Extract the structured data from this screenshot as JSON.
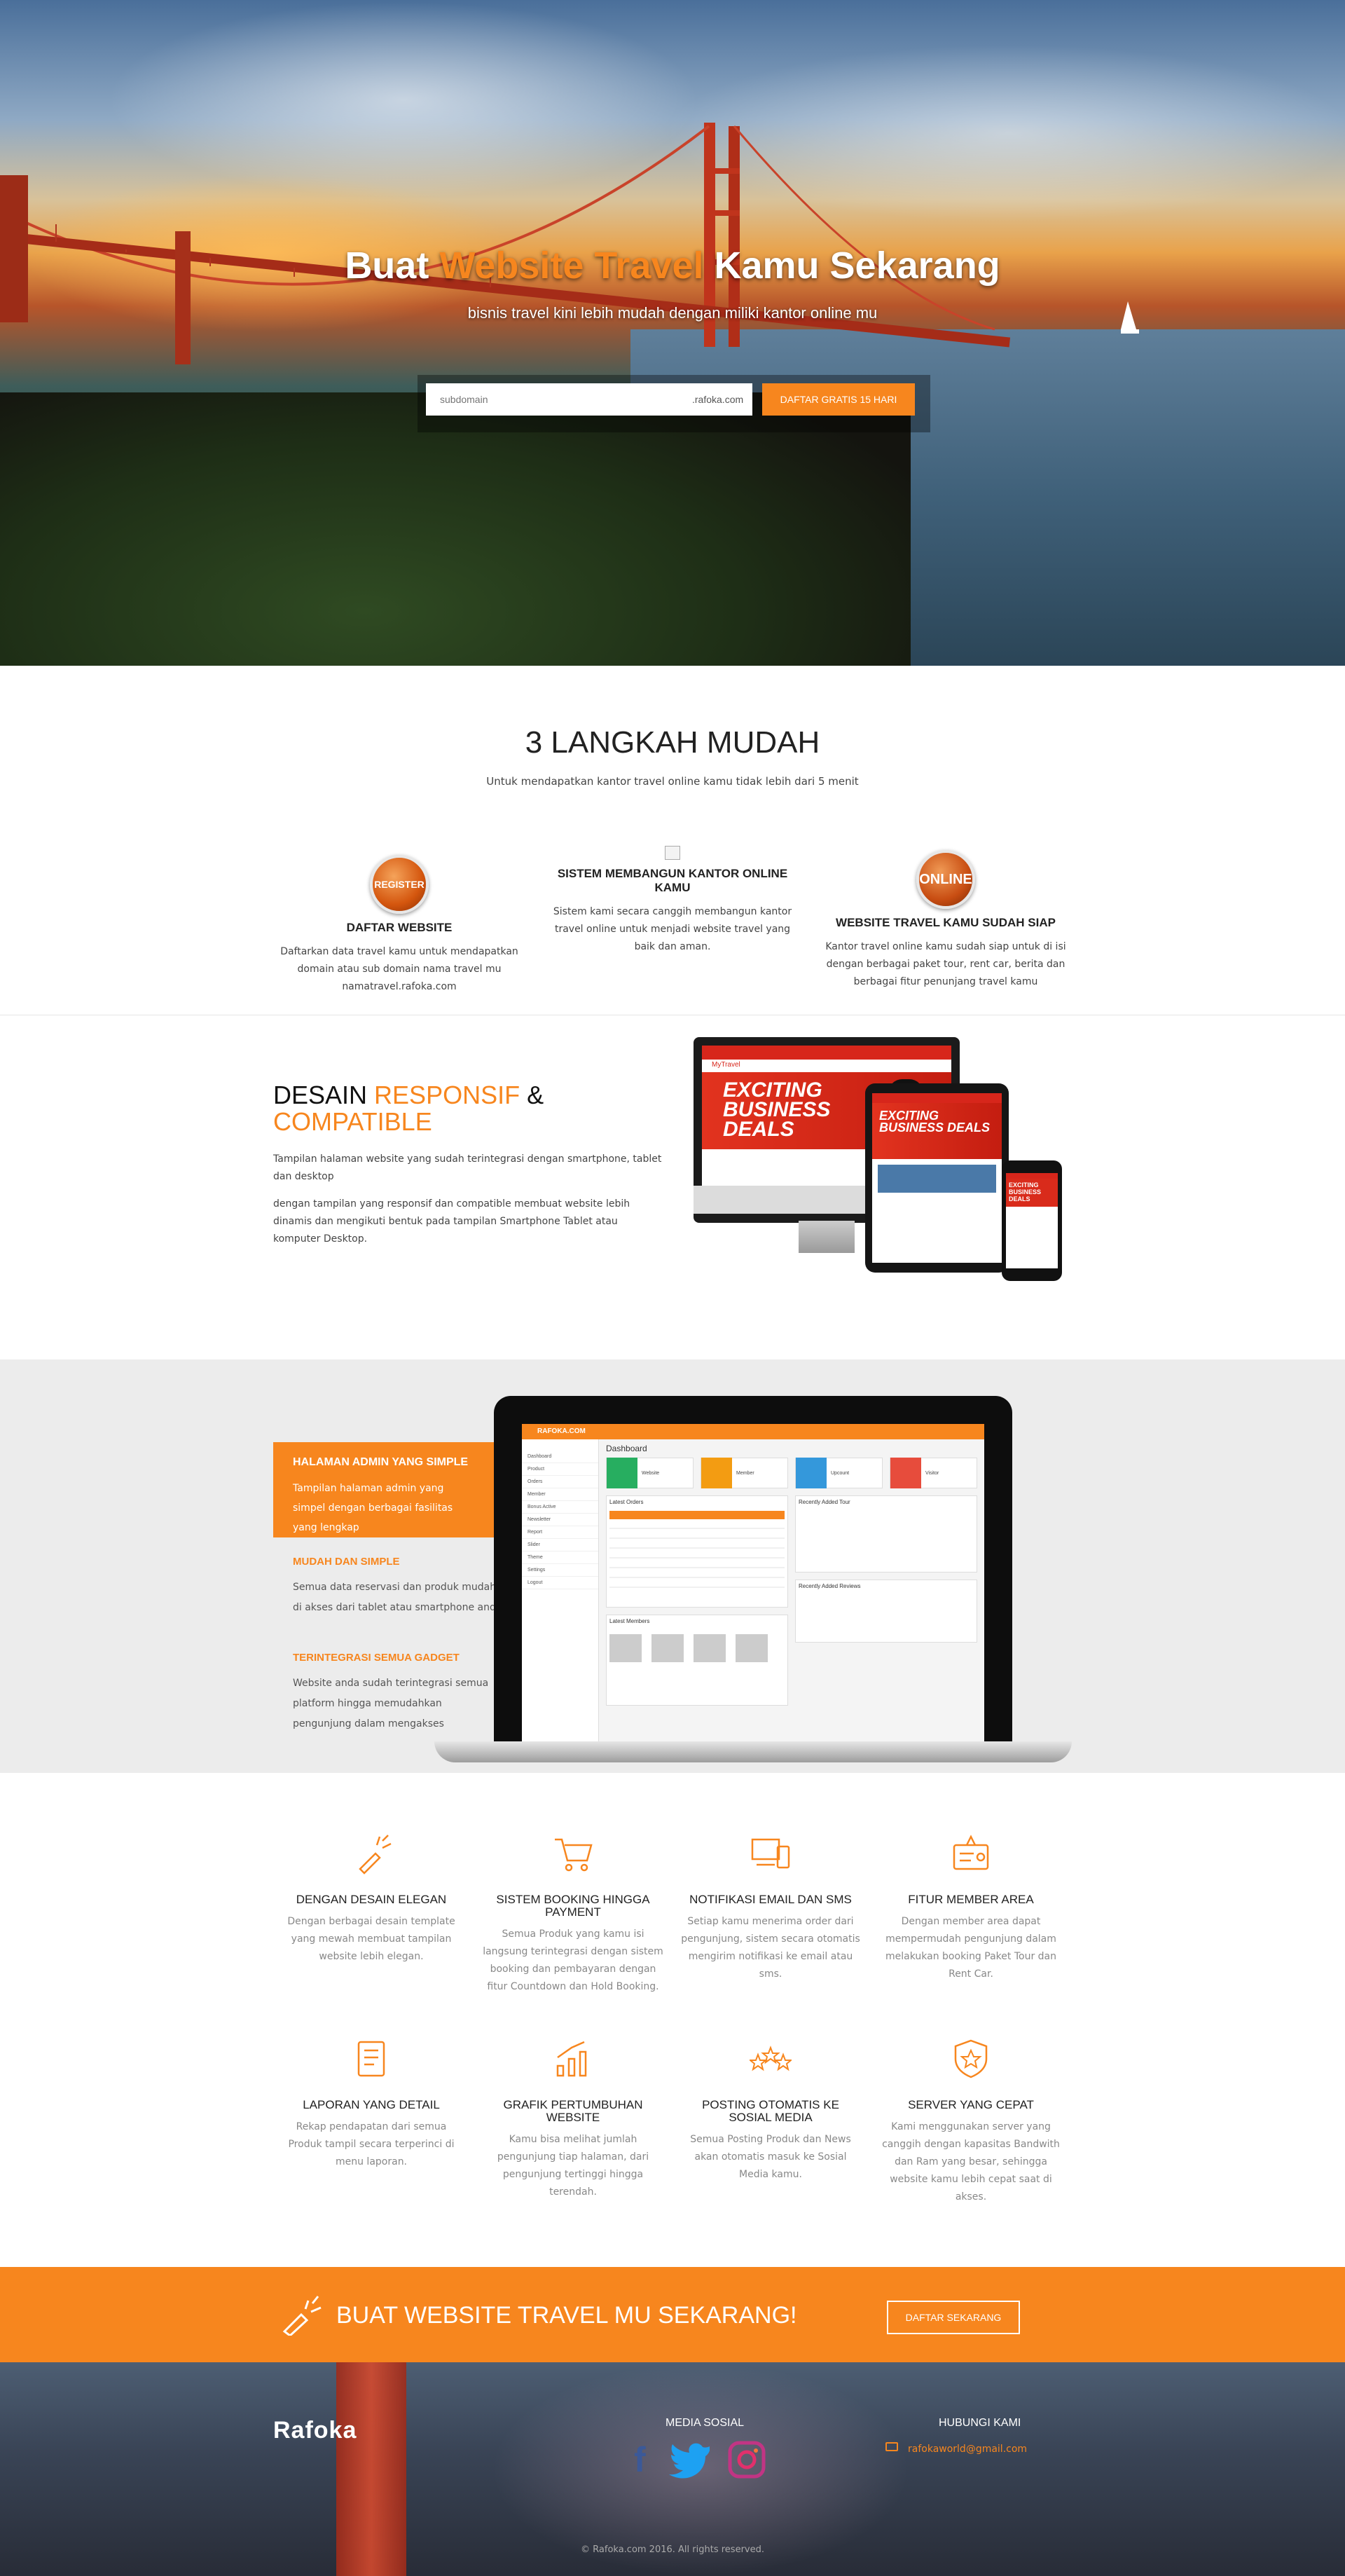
{
  "hero": {
    "title_pre": "Buat ",
    "title_highlight": "Website Travel",
    "title_post": " Kamu Sekarang",
    "subtitle": "bisnis travel kini lebih mudah dengan miliki kantor online mu",
    "subdomain_placeholder": "subdomain",
    "domain_suffix": ".rafoka.com",
    "signup_button": "DAFTAR GRATIS 15 HARI"
  },
  "steps": {
    "title": "3 LANGKAH MUDAH",
    "subtitle": "Untuk mendapatkan kantor travel online kamu tidak lebih dari 5 menit",
    "items": [
      {
        "icon_text": "REGISTER",
        "heading": "DAFTAR WEBSITE",
        "text": "Daftarkan data travel kamu untuk mendapatkan domain atau sub domain nama travel mu namatravel.rafoka.com"
      },
      {
        "heading": "SISTEM MEMBANGUN KANTOR ONLINE KAMU",
        "text": "Sistem kami secara canggih membangun kantor travel online untuk menjadi website travel yang baik dan aman."
      },
      {
        "icon_text": "ONLINE",
        "heading": "WEBSITE TRAVEL KAMU SUDAH SIAP",
        "text": "Kantor travel online kamu sudah siap untuk di isi dengan berbagai paket tour, rent car, berita dan berbagai fitur penunjang travel kamu"
      }
    ]
  },
  "responsive": {
    "title_a": "DESAIN ",
    "title_b": "RESPONSIF",
    "title_c": " &",
    "title_d": "COMPATIBLE",
    "p1": "Tampilan halaman website yang sudah terintegrasi dengan smartphone, tablet dan desktop",
    "p2": "dengan tampilan yang responsif dan compatible membuat website lebih dinamis dan mengikuti bentuk pada tampilan Smartphone Tablet atau komputer Desktop.",
    "screen_brand": "MyTravel",
    "screen_promo": "EXCITING BUSINESS DEALS"
  },
  "admin": {
    "box_title": "HALAMAN ADMIN YANG SIMPLE",
    "box_text": "Tampilan halaman admin yang simpel dengan berbagai fasilitas yang lengkap",
    "item1_title": "MUDAH DAN SIMPLE",
    "item1_text": "Semua data reservasi dan produk mudah di akses dari tablet atau smartphone anda",
    "item2_title": "TERINTEGRASI SEMUA GADGET",
    "item2_text": "Website anda sudah terintegrasi semua platform hingga memudahkan pengunjung dalam mengakses",
    "dash_brand": "RAFOKA.COM",
    "dash_title": "Dashboard",
    "dash_cards": [
      "Website",
      "Member",
      "Upcount",
      "Visitor"
    ],
    "dash_sidebar": [
      "Dashboard",
      "Product",
      "Orders",
      "Member",
      "Bonus Active",
      "Newsletter",
      "Report",
      "Slider",
      "Theme",
      "Settings",
      "Logout"
    ],
    "dash_panels": [
      "Latest Orders",
      "Recently Added Tour",
      "Latest Members",
      "Recently Added Reviews"
    ]
  },
  "features": [
    {
      "icon": "magic-wand-icon",
      "title": "DENGAN DESAIN ELEGAN",
      "text": "Dengan berbagai desain template yang mewah membuat tampilan website lebih elegan."
    },
    {
      "icon": "cart-icon",
      "title": "SISTEM BOOKING HINGGA PAYMENT",
      "text": "Semua Produk yang kamu isi langsung terintegrasi dengan sistem booking dan pembayaran dengan fitur Countdown dan Hold Booking."
    },
    {
      "icon": "devices-icon",
      "title": "NOTIFIKASI EMAIL DAN SMS",
      "text": "Setiap kamu menerima order dari pengunjung, sistem secara otomatis mengirim notifikasi ke email atau sms."
    },
    {
      "icon": "member-card-icon",
      "title": "FITUR MEMBER AREA",
      "text": "Dengan member area dapat mempermudah pengunjung dalam melakukan booking Paket Tour dan Rent Car."
    },
    {
      "icon": "report-icon",
      "title": "LAPORAN YANG DETAIL",
      "text": "Rekap pendapatan dari semua Produk tampil secara terperinci di menu laporan."
    },
    {
      "icon": "growth-chart-icon",
      "title": "GRAFIK PERTUMBUHAN WEBSITE",
      "text": "Kamu bisa melihat jumlah pengunjung tiap halaman, dari pengunjung tertinggi hingga terendah."
    },
    {
      "icon": "stars-icon",
      "title": "POSTING OTOMATIS KE SOSIAL MEDIA",
      "text": "Semua Posting Produk dan News akan otomatis masuk ke Sosial Media kamu."
    },
    {
      "icon": "shield-star-icon",
      "title": "SERVER YANG CEPAT",
      "text": "Kami menggunakan server yang canggih dengan kapasitas Bandwith dan Ram yang besar, sehingga website kamu lebih cepat saat di akses."
    }
  ],
  "cta": {
    "text": "BUAT WEBSITE TRAVEL MU SEKARANG!",
    "button": "DAFTAR SEKARANG"
  },
  "footer": {
    "logo": "Rafoka",
    "social_title": "MEDIA SOSIAL",
    "contact_title": "HUBUNGI KAMI",
    "email": "rafokaworld@gmail.com",
    "copyright": "© Rafoka.com 2016. All rights reserved."
  },
  "colors": {
    "accent": "#f7861e",
    "footer": "#2f3645",
    "admin_bg": "#ececec"
  }
}
